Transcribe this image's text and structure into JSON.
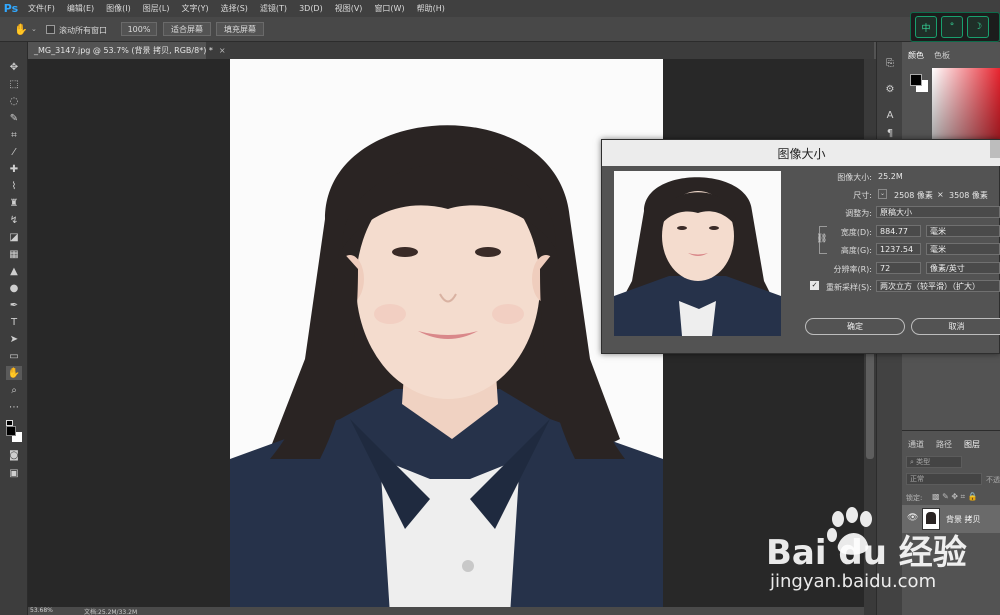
{
  "app": {
    "logo": "Ps",
    "accent": "#31a8ff"
  },
  "menu": [
    "文件(F)",
    "编辑(E)",
    "图像(I)",
    "图层(L)",
    "文字(Y)",
    "选择(S)",
    "滤镜(T)",
    "3D(D)",
    "视图(V)",
    "窗口(W)",
    "帮助(H)"
  ],
  "options": {
    "scroll_all_label": "滚动所有窗口",
    "zoom_value": "100%",
    "fit_screen": "适合屏幕",
    "fill_screen": "填充屏幕"
  },
  "ime": {
    "keys": [
      "中",
      "°",
      "☽"
    ]
  },
  "document": {
    "tab_title": "_MG_3147.jpg @ 53.7% (背景 拷贝, RGB/8*) *",
    "tab_close": "×"
  },
  "panels": {
    "color_tabs": [
      "颜色",
      "色板"
    ],
    "layer_tabs": [
      "通道",
      "路径",
      "图层"
    ],
    "layer_filter": "类型",
    "blend_mode": "正常",
    "opacity_label": "不透",
    "lock_label": "锁定:",
    "layer_name": "背景 拷贝"
  },
  "dialog": {
    "title": "图像大小",
    "image_size_label": "图像大小:",
    "image_size_value": "25.2M",
    "dimensions_label": "尺寸:",
    "dimensions_width": "2508 像素",
    "dimensions_x": "×",
    "dimensions_height": "3508 像素",
    "fit_to_label": "调整为:",
    "fit_to_value": "原稿大小",
    "width_label": "宽度(D):",
    "width_value": "884.77",
    "width_unit": "毫米",
    "height_label": "高度(G):",
    "height_value": "1237.54",
    "height_unit": "毫米",
    "resolution_label": "分辨率(R):",
    "resolution_value": "72",
    "resolution_unit": "像素/英寸",
    "resample_label": "重新采样(S):",
    "resample_value": "两次立方（较平滑）（扩大）",
    "ok": "确定",
    "cancel": "取消"
  },
  "status": {
    "zoom": "53.68%",
    "doc": "文档:25.2M/33.2M"
  },
  "watermark": {
    "brand": "Bai du 经验",
    "url": "jingyan.baidu.com"
  }
}
